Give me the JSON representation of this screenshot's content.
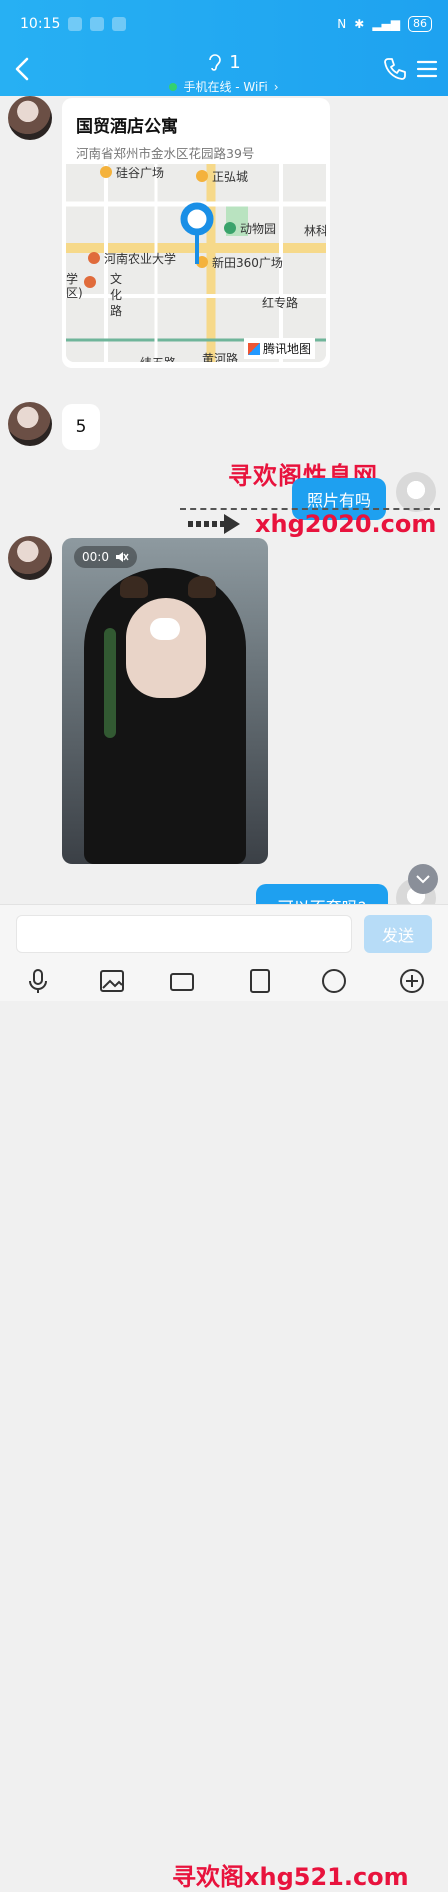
{
  "status_bar": {
    "time": "10:15",
    "battery": "86"
  },
  "header": {
    "title": "1",
    "subtitle": "手机在线 - WiFi",
    "subtitle_arrow": "›"
  },
  "messages": {
    "location": {
      "title": "国贸酒店公寓",
      "address": "河南省郑州市金水区花园路39号"
    },
    "map_labels": {
      "l1": "硅谷广场",
      "l2": "正弘城",
      "l3": "动物园",
      "l4": "林科",
      "l5": "河南农业大学",
      "l6": "新田360广场",
      "l7": "学",
      "l8": "文",
      "l9": "化",
      "l10": "路",
      "l11": "红专路",
      "l12": "黄河路",
      "l13": "纬五路",
      "l14": "腾讯地图",
      "l15": "区)"
    },
    "number_msg": "5",
    "sent1": "照片有吗",
    "video_time": "00:0",
    "sent2": "可以不套吗?"
  },
  "watermarks": {
    "w1": "寻欢阁性息网",
    "w2": "xhg2020.com",
    "w3": "寻欢阁xhg521.com"
  },
  "input_bar": {
    "send_label": "发送"
  },
  "colors": {
    "primary": "#1ea0f0",
    "watermark": "#e8133d"
  }
}
